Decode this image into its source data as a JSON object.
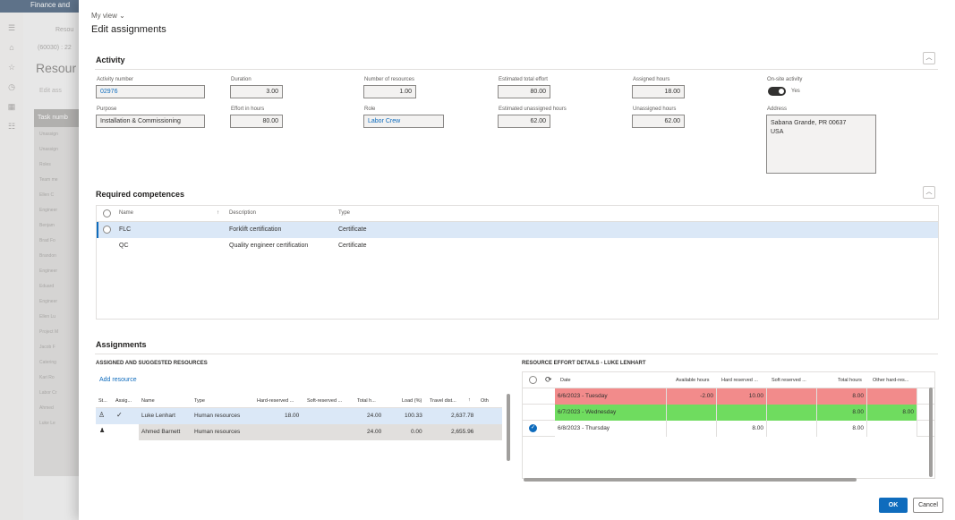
{
  "background": {
    "app_title": "Finance and",
    "back_label": "Resou",
    "breadcrumb": "(60030) : 22",
    "page_title": "Resour",
    "edit_label": "Edit ass",
    "task_header": "Task numb",
    "task_rows": [
      "Unassign",
      "Unassign",
      "Roles",
      "Team me",
      "Ellen C",
      "Engineer",
      "Benjam",
      "Brad Fo",
      "Brandon",
      "Engineer",
      "Eduard",
      "Engineer",
      "Ellen Lu",
      "Project M",
      "Jacob F",
      "Catering",
      "Kari Ro",
      "Labor Cr",
      "Ahmed",
      "Luke Le"
    ]
  },
  "dialog": {
    "my_view": "My view",
    "title": "Edit assignments"
  },
  "activity": {
    "section_title": "Activity",
    "fields": {
      "activity_number": {
        "label": "Activity number",
        "value": "02976"
      },
      "duration": {
        "label": "Duration",
        "value": "3.00"
      },
      "number_of_resources": {
        "label": "Number of resources",
        "value": "1.00"
      },
      "estimated_total_effort": {
        "label": "Estimated total effort",
        "value": "80.00"
      },
      "assigned_hours": {
        "label": "Assigned hours",
        "value": "18.00"
      },
      "on_site_activity": {
        "label": "On-site activity",
        "value": "Yes"
      },
      "purpose": {
        "label": "Purpose",
        "value": "Installation & Commissioning"
      },
      "effort_in_hours": {
        "label": "Effort in hours",
        "value": "80.00"
      },
      "role": {
        "label": "Role",
        "value": "Labor Crew"
      },
      "estimated_unassigned_hours": {
        "label": "Estimated unassigned hours",
        "value": "62.00"
      },
      "unassigned_hours": {
        "label": "Unassigned hours",
        "value": "62.00"
      },
      "address": {
        "label": "Address",
        "line1": "Sabana Grande, PR 00637",
        "line2": "USA"
      }
    }
  },
  "competences": {
    "section_title": "Required competences",
    "columns": {
      "name": "Name",
      "description": "Description",
      "type": "Type"
    },
    "rows": [
      {
        "name": "FLC",
        "description": "Forklift certification",
        "type": "Certificate"
      },
      {
        "name": "QC",
        "description": "Quality engineer certification",
        "type": "Certificate"
      }
    ]
  },
  "assignments": {
    "section_title": "Assignments",
    "left": {
      "header": "ASSIGNED AND SUGGESTED RESOURCES",
      "add_resource": "Add resource",
      "columns": [
        "St...",
        "Assig...",
        "Name",
        "Type",
        "Hard-reserved ...",
        "Soft-reserved ...",
        "Total h...",
        "Load (%)",
        "Travel dist...",
        "Oth"
      ],
      "rows": [
        {
          "assigned": "✓",
          "name": "Luke Lenhart",
          "type": "Human resources",
          "hard_reserved": "18.00",
          "soft_reserved": "",
          "total_hours": "24.00",
          "load": "100.33",
          "travel": "2,637.78"
        },
        {
          "assigned": "",
          "name": "Ahmed Barnett",
          "type": "Human resources",
          "hard_reserved": "",
          "soft_reserved": "",
          "total_hours": "24.00",
          "load": "0.00",
          "travel": "2,655.96"
        }
      ]
    },
    "right": {
      "header": "RESOURCE EFFORT DETAILS - LUKE LENHART",
      "columns": [
        "Date",
        "Available hours",
        "Hard reserved ...",
        "Soft reserved ...",
        "Total hours",
        "Other hard-res..."
      ],
      "rows": [
        {
          "date": "6/6/2023 - Tuesday",
          "available": "-2.00",
          "hard": "10.00",
          "soft": "",
          "total": "8.00",
          "other": "",
          "color": "#f28b8b"
        },
        {
          "date": "6/7/2023 - Wednesday",
          "available": "",
          "hard": "",
          "soft": "",
          "total": "8.00",
          "other": "8.00",
          "color": "#6fdc5f"
        },
        {
          "date": "6/8/2023 - Thursday",
          "available": "",
          "hard": "8.00",
          "soft": "",
          "total": "8.00",
          "other": "",
          "color": "#ffffff"
        }
      ]
    }
  },
  "buttons": {
    "ok": "OK",
    "cancel": "Cancel"
  },
  "colors": {
    "accent": "#0f6cbd",
    "over": "#f28b8b",
    "free": "#6fdc5f"
  }
}
